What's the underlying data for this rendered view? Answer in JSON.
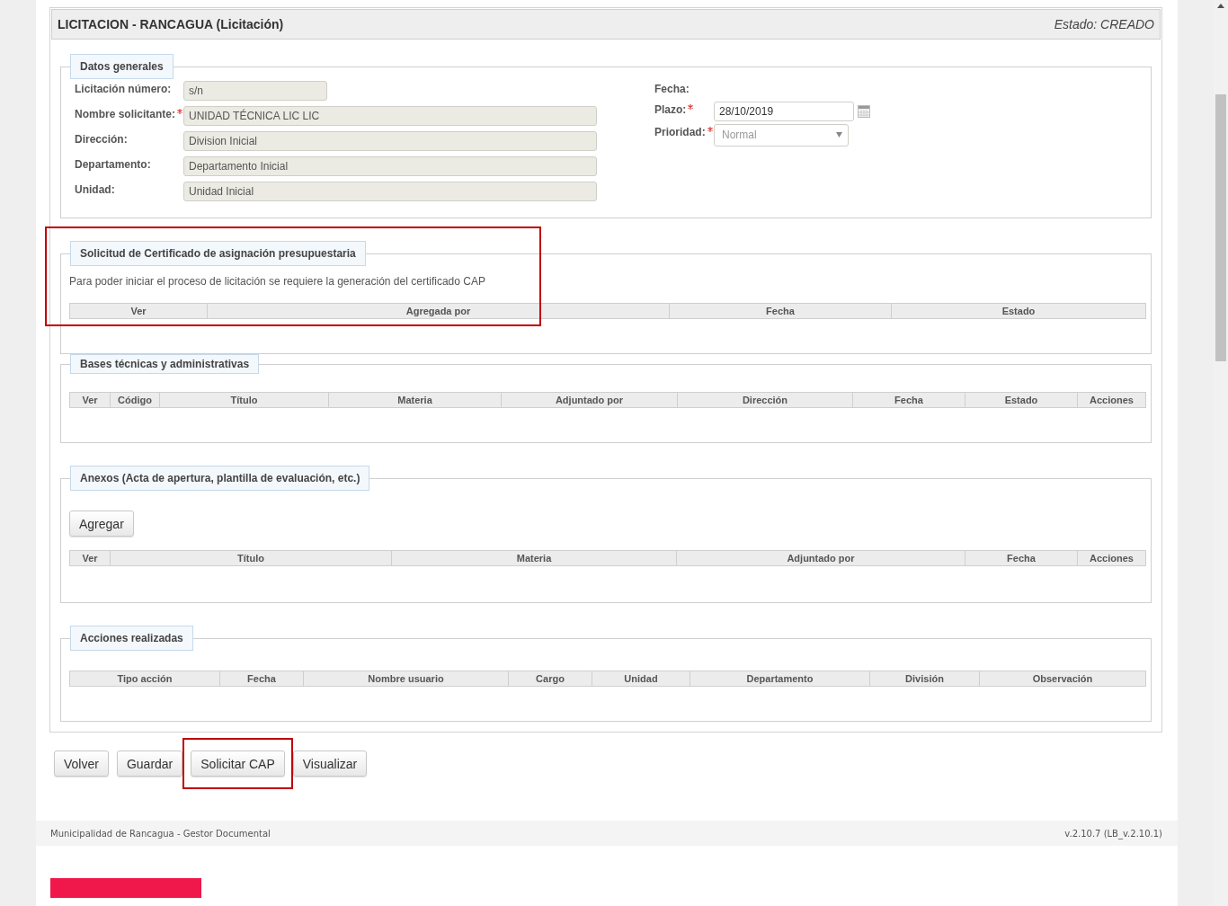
{
  "header": {
    "title": "LICITACION - RANCAGUA (Licitación)",
    "status": "Estado: CREADO"
  },
  "general": {
    "legend": "Datos generales",
    "left_fields": [
      {
        "label": "Licitación número:",
        "required": false,
        "kind": "short",
        "value": "s/n"
      },
      {
        "label": "Nombre solicitante:",
        "required": true,
        "kind": "long",
        "value": "UNIDAD TÉCNICA LIC LIC"
      },
      {
        "label": "Dirección:",
        "required": false,
        "kind": "long",
        "value": "Division Inicial"
      },
      {
        "label": "Departamento:",
        "required": false,
        "kind": "long",
        "value": "Departamento Inicial"
      },
      {
        "label": "Unidad:",
        "required": false,
        "kind": "long",
        "value": "Unidad Inicial"
      }
    ],
    "right_fields": [
      {
        "label": "Fecha:",
        "required": false,
        "kind": "none"
      },
      {
        "label": "Plazo:",
        "required": true,
        "kind": "date",
        "value": "28/10/2019"
      },
      {
        "label": "Prioridad:",
        "required": true,
        "kind": "select",
        "value": "Normal",
        "disabled": true
      }
    ]
  },
  "sections": [
    {
      "legend": "Solicitud de Certificado de asignación presupuestaria",
      "highlighted": true,
      "note": "Para poder iniciar el proceso de licitación se requiere la generación del certificado CAP",
      "columns": [
        "Ver",
        "Agregada por",
        "Fecha",
        "Estado"
      ]
    },
    {
      "legend": "Bases técnicas y administrativas",
      "highlighted": false,
      "columns": [
        "Ver",
        "Código",
        "Título",
        "Materia",
        "Adjuntado por",
        "Dirección",
        "Fecha",
        "Estado",
        "Acciones"
      ]
    },
    {
      "legend": "Anexos (Acta de apertura, plantilla de evaluación, etc.)",
      "highlighted": false,
      "button": "Agregar",
      "columns": [
        "Ver",
        "Título",
        "Materia",
        "Adjuntado por",
        "Fecha",
        "Acciones"
      ]
    },
    {
      "legend": "Acciones realizadas",
      "highlighted": false,
      "columns": [
        "Tipo acción",
        "Fecha",
        "Nombre usuario",
        "Cargo",
        "Unidad",
        "Departamento",
        "División",
        "Observación"
      ]
    }
  ],
  "actions": [
    {
      "label": "Volver",
      "highlighted": false
    },
    {
      "label": "Guardar",
      "highlighted": false
    },
    {
      "label": "Solicitar CAP",
      "highlighted": true
    },
    {
      "label": "Visualizar",
      "highlighted": false
    }
  ],
  "footer": {
    "left": "Municipalidad de Rancagua - Gestor Documental",
    "right": "v.2.10.7 (LB_v.2.10.1)"
  }
}
